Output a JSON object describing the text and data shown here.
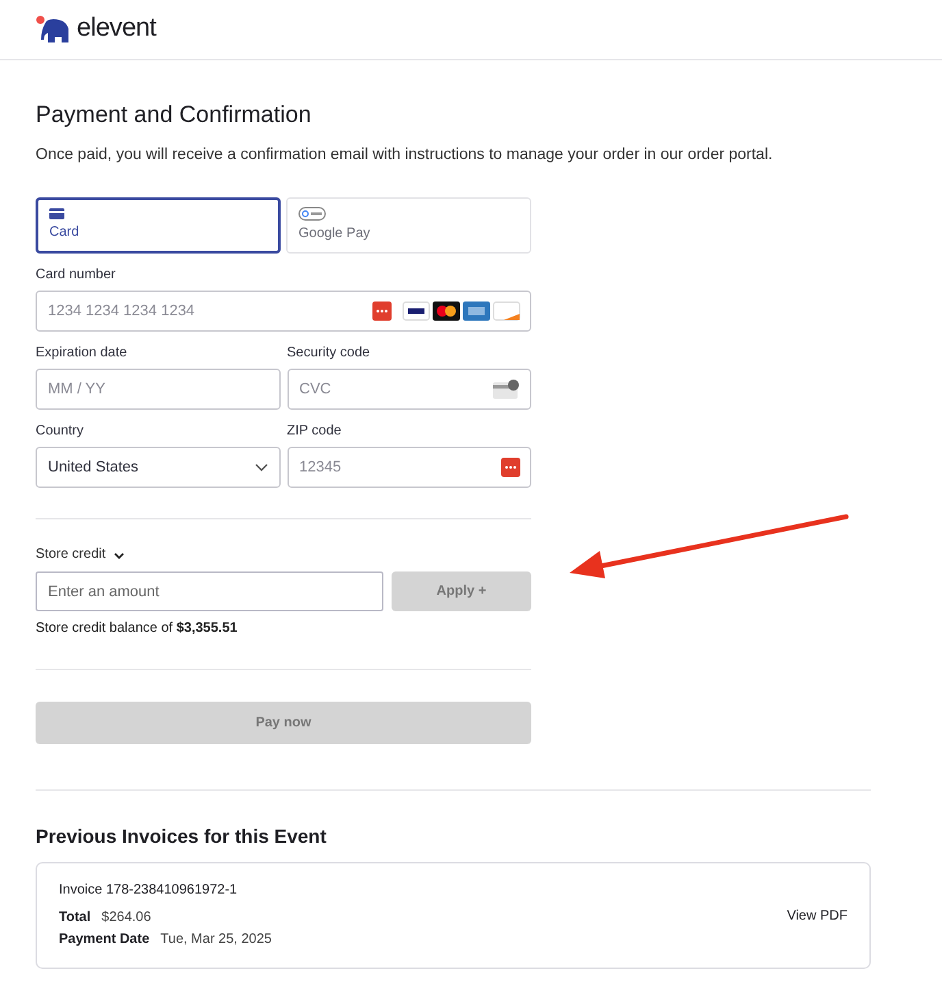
{
  "brand": {
    "name": "elevent"
  },
  "title": "Payment and Confirmation",
  "description": "Once paid, you will receive a confirmation email with instructions to manage your order in our order portal.",
  "methods": [
    {
      "kind": "card",
      "label": "Card",
      "selected": true
    },
    {
      "kind": "wallet",
      "label": "Google Pay",
      "selected": false
    }
  ],
  "card_number": {
    "label": "Card number",
    "placeholder": "1234 1234 1234 1234"
  },
  "expiration": {
    "label": "Expiration date",
    "placeholder": "MM / YY"
  },
  "security": {
    "label": "Security code",
    "placeholder": "CVC"
  },
  "country": {
    "label": "Country",
    "value": "United States"
  },
  "zip": {
    "label": "ZIP code",
    "placeholder": "12345"
  },
  "store_credit": {
    "label": "Store credit",
    "expanded": true,
    "placeholder": "Enter an amount",
    "apply": "Apply +",
    "apply_disabled": true,
    "balance": "Store credit balance of **$3,355.51**"
  },
  "pay": {
    "label": "Pay now",
    "disabled": true
  },
  "invoices": {
    "title": "Previous Invoices for this Event",
    "items": [
      {
        "number": "Invoice 178-238410961972-1",
        "total_label": "Total",
        "total": "$264.06",
        "date_label": "Payment Date",
        "date": "Tue, Mar 25, 2025",
        "link": "View PDF"
      }
    ]
  }
}
